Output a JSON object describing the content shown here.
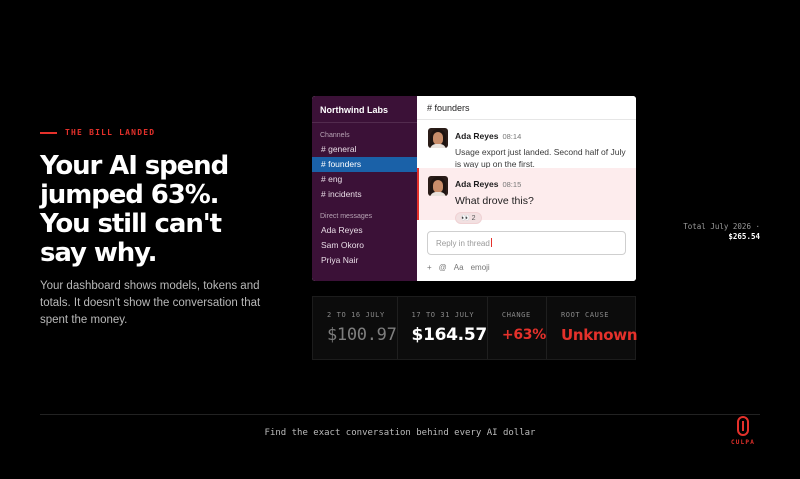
{
  "hero": {
    "eyebrow": "THE BILL LANDED",
    "headline": [
      "Your AI spend",
      "jumped 63%.",
      "You still can't",
      "say why."
    ],
    "subtext": "Your dashboard shows models, tokens and totals. It doesn't show the conversation that spent the money."
  },
  "slack": {
    "workspace": "Northwind Labs",
    "channels_label": "Channels",
    "channels": [
      "# general",
      "# founders",
      "# eng",
      "# incidents"
    ],
    "active_channel": "# founders",
    "dm_label": "Direct messages",
    "dms": [
      "Ada Reyes",
      "Sam Okoro",
      "Priya Nair"
    ],
    "channel_header": "# founders",
    "messages": [
      {
        "author": "Ada Reyes",
        "time": "08:14",
        "text": "Usage export just landed. Second half of July is way up on the first."
      },
      {
        "author": "Ada Reyes",
        "time": "08:15",
        "text": "What drove this?",
        "reaction": "👀 2"
      }
    ],
    "reply_placeholder": "Reply in thread",
    "toolbar": {
      "plus": "+",
      "at": "@",
      "format": "Aa",
      "emoji": "emoji"
    }
  },
  "stats": [
    {
      "label": "2 TO 16 JULY",
      "value": "$100.97"
    },
    {
      "label": "17 TO 31 JULY",
      "value": "$164.57"
    },
    {
      "label": "CHANGE",
      "value": "+63%"
    },
    {
      "label": "ROOT CAUSE",
      "value": "Unknown"
    }
  ],
  "tooltip": {
    "line1": "Total July 2026 ·",
    "line2": "$265.54"
  },
  "footer": {
    "tagline": "Find the exact conversation behind every AI dollar",
    "brand": "CULPA"
  },
  "colors": {
    "accent": "#e5312b",
    "sidebar": "#3b1137",
    "active": "#1a61a8"
  }
}
